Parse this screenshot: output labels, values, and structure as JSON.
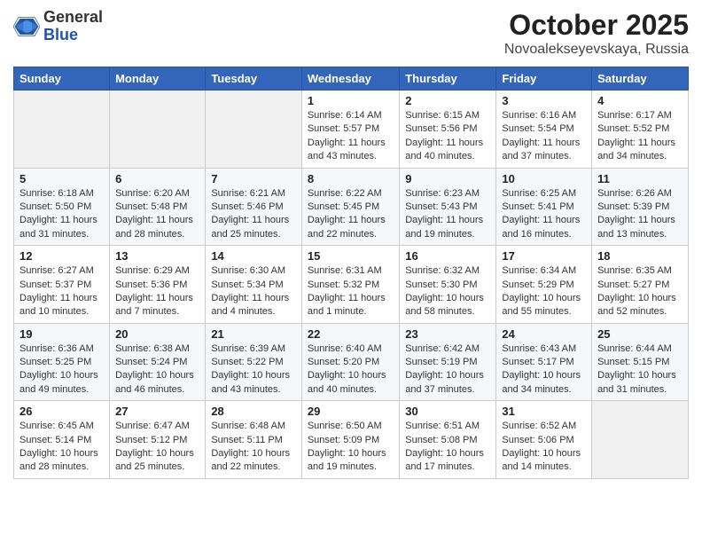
{
  "header": {
    "logo": {
      "line1": "General",
      "line2": "Blue"
    },
    "title": "October 2025",
    "subtitle": "Novoalekseyevskaya, Russia"
  },
  "weekdays": [
    "Sunday",
    "Monday",
    "Tuesday",
    "Wednesday",
    "Thursday",
    "Friday",
    "Saturday"
  ],
  "weeks": [
    [
      {
        "day": "",
        "info": ""
      },
      {
        "day": "",
        "info": ""
      },
      {
        "day": "",
        "info": ""
      },
      {
        "day": "1",
        "info": "Sunrise: 6:14 AM\nSunset: 5:57 PM\nDaylight: 11 hours and 43 minutes."
      },
      {
        "day": "2",
        "info": "Sunrise: 6:15 AM\nSunset: 5:56 PM\nDaylight: 11 hours and 40 minutes."
      },
      {
        "day": "3",
        "info": "Sunrise: 6:16 AM\nSunset: 5:54 PM\nDaylight: 11 hours and 37 minutes."
      },
      {
        "day": "4",
        "info": "Sunrise: 6:17 AM\nSunset: 5:52 PM\nDaylight: 11 hours and 34 minutes."
      }
    ],
    [
      {
        "day": "5",
        "info": "Sunrise: 6:18 AM\nSunset: 5:50 PM\nDaylight: 11 hours and 31 minutes."
      },
      {
        "day": "6",
        "info": "Sunrise: 6:20 AM\nSunset: 5:48 PM\nDaylight: 11 hours and 28 minutes."
      },
      {
        "day": "7",
        "info": "Sunrise: 6:21 AM\nSunset: 5:46 PM\nDaylight: 11 hours and 25 minutes."
      },
      {
        "day": "8",
        "info": "Sunrise: 6:22 AM\nSunset: 5:45 PM\nDaylight: 11 hours and 22 minutes."
      },
      {
        "day": "9",
        "info": "Sunrise: 6:23 AM\nSunset: 5:43 PM\nDaylight: 11 hours and 19 minutes."
      },
      {
        "day": "10",
        "info": "Sunrise: 6:25 AM\nSunset: 5:41 PM\nDaylight: 11 hours and 16 minutes."
      },
      {
        "day": "11",
        "info": "Sunrise: 6:26 AM\nSunset: 5:39 PM\nDaylight: 11 hours and 13 minutes."
      }
    ],
    [
      {
        "day": "12",
        "info": "Sunrise: 6:27 AM\nSunset: 5:37 PM\nDaylight: 11 hours and 10 minutes."
      },
      {
        "day": "13",
        "info": "Sunrise: 6:29 AM\nSunset: 5:36 PM\nDaylight: 11 hours and 7 minutes."
      },
      {
        "day": "14",
        "info": "Sunrise: 6:30 AM\nSunset: 5:34 PM\nDaylight: 11 hours and 4 minutes."
      },
      {
        "day": "15",
        "info": "Sunrise: 6:31 AM\nSunset: 5:32 PM\nDaylight: 11 hours and 1 minute."
      },
      {
        "day": "16",
        "info": "Sunrise: 6:32 AM\nSunset: 5:30 PM\nDaylight: 10 hours and 58 minutes."
      },
      {
        "day": "17",
        "info": "Sunrise: 6:34 AM\nSunset: 5:29 PM\nDaylight: 10 hours and 55 minutes."
      },
      {
        "day": "18",
        "info": "Sunrise: 6:35 AM\nSunset: 5:27 PM\nDaylight: 10 hours and 52 minutes."
      }
    ],
    [
      {
        "day": "19",
        "info": "Sunrise: 6:36 AM\nSunset: 5:25 PM\nDaylight: 10 hours and 49 minutes."
      },
      {
        "day": "20",
        "info": "Sunrise: 6:38 AM\nSunset: 5:24 PM\nDaylight: 10 hours and 46 minutes."
      },
      {
        "day": "21",
        "info": "Sunrise: 6:39 AM\nSunset: 5:22 PM\nDaylight: 10 hours and 43 minutes."
      },
      {
        "day": "22",
        "info": "Sunrise: 6:40 AM\nSunset: 5:20 PM\nDaylight: 10 hours and 40 minutes."
      },
      {
        "day": "23",
        "info": "Sunrise: 6:42 AM\nSunset: 5:19 PM\nDaylight: 10 hours and 37 minutes."
      },
      {
        "day": "24",
        "info": "Sunrise: 6:43 AM\nSunset: 5:17 PM\nDaylight: 10 hours and 34 minutes."
      },
      {
        "day": "25",
        "info": "Sunrise: 6:44 AM\nSunset: 5:15 PM\nDaylight: 10 hours and 31 minutes."
      }
    ],
    [
      {
        "day": "26",
        "info": "Sunrise: 6:45 AM\nSunset: 5:14 PM\nDaylight: 10 hours and 28 minutes."
      },
      {
        "day": "27",
        "info": "Sunrise: 6:47 AM\nSunset: 5:12 PM\nDaylight: 10 hours and 25 minutes."
      },
      {
        "day": "28",
        "info": "Sunrise: 6:48 AM\nSunset: 5:11 PM\nDaylight: 10 hours and 22 minutes."
      },
      {
        "day": "29",
        "info": "Sunrise: 6:50 AM\nSunset: 5:09 PM\nDaylight: 10 hours and 19 minutes."
      },
      {
        "day": "30",
        "info": "Sunrise: 6:51 AM\nSunset: 5:08 PM\nDaylight: 10 hours and 17 minutes."
      },
      {
        "day": "31",
        "info": "Sunrise: 6:52 AM\nSunset: 5:06 PM\nDaylight: 10 hours and 14 minutes."
      },
      {
        "day": "",
        "info": ""
      }
    ]
  ]
}
